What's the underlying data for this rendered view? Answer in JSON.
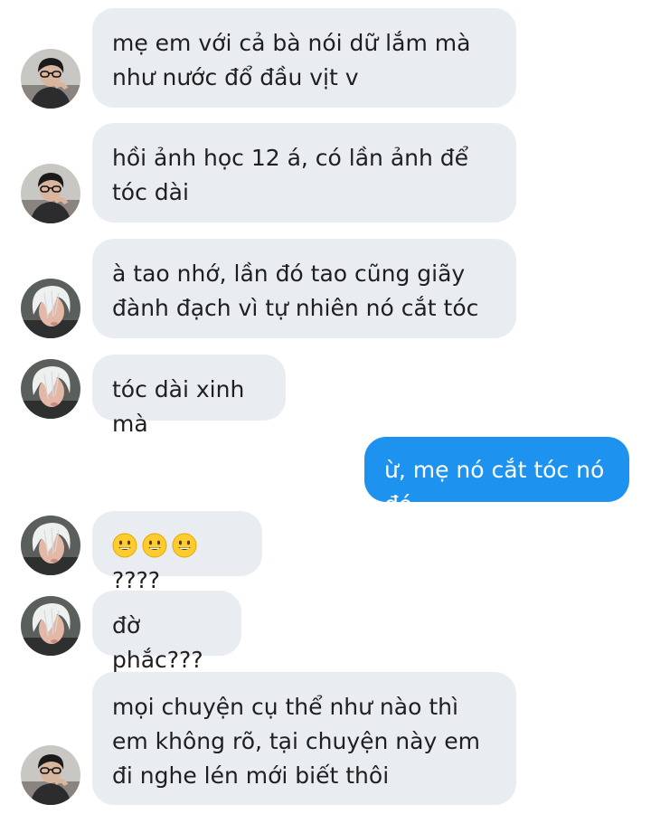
{
  "messages": [
    {
      "sender": "them",
      "avatar": "boy-glasses-avatar",
      "text": "mẹ em với cả bà nói dữ lắm mà như nước đổ đầu vịt v"
    },
    {
      "sender": "them",
      "avatar": "boy-glasses-avatar",
      "text": "hồi ảnh học 12 á, có lần ảnh để tóc dài"
    },
    {
      "sender": "them",
      "avatar": "white-hair-avatar",
      "text": "à tao nhớ, lần đó tao cũng giãy đành đạch vì tự nhiên nó cắt tóc"
    },
    {
      "sender": "them",
      "avatar": "white-hair-avatar",
      "text": "tóc dài xinh mà"
    },
    {
      "sender": "me",
      "text": "ừ, mẹ nó cắt tóc nó đó"
    },
    {
      "sender": "them",
      "avatar": "white-hair-avatar",
      "emojis": [
        "grinning-face-icon",
        "grinning-face-icon",
        "grinning-face-icon"
      ],
      "text": "????"
    },
    {
      "sender": "them",
      "avatar": "white-hair-avatar",
      "text": "đờ phắc???"
    },
    {
      "sender": "them",
      "avatar": "boy-glasses-avatar",
      "text": "mọi chuyện cụ thể như nào thì em không rõ, tại chuyện này em đi nghe lén mới biết thôi"
    }
  ],
  "colors": {
    "incoming_bubble": "#e9edf1",
    "outgoing_bubble": "#1d93ef",
    "text": "#1f1f1f",
    "outgoing_text": "#ffffff"
  }
}
